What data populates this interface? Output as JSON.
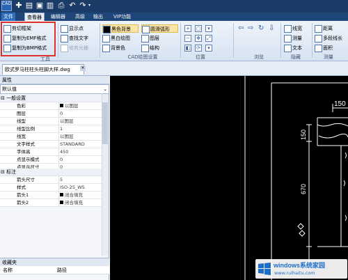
{
  "app": {
    "icon_label": "CAD"
  },
  "menu": [
    "文件",
    "查看器",
    "编辑器",
    "高级",
    "输出",
    "VIP功能"
  ],
  "ribbon": {
    "copy_group": {
      "items": [
        "剪切框架",
        "复制为EMF格式",
        "复制为BMP格式"
      ],
      "label": "工具"
    },
    "view_group": {
      "items": [
        "显示点",
        "查找文字",
        "修剪光栅"
      ]
    },
    "cad_group": {
      "col1": [
        "黑色背景",
        "黑白绘图",
        "背景色"
      ],
      "col2": [
        "圆滑弧形",
        "图层",
        "结构"
      ],
      "label": "CAD绘图设置"
    },
    "position_label": "位置",
    "browse_label": "浏览",
    "hide_group": {
      "items": [
        "线宽",
        "测量",
        "文本"
      ],
      "label": "隐藏"
    },
    "measure_group": {
      "items": [
        "距离",
        "多段线长",
        "面积"
      ],
      "label": "测量"
    }
  },
  "document": {
    "tab": "欧式罗马柱柱头柱脚大样.dwg"
  },
  "properties": {
    "title": "属性",
    "selector": "默认值",
    "general_header": "一般设置",
    "general": [
      {
        "k": "色彩",
        "v": "以图层",
        "swatch": true
      },
      {
        "k": "图层",
        "v": "0"
      },
      {
        "k": "线型",
        "v": "以图层"
      },
      {
        "k": "线型比例",
        "v": "1"
      },
      {
        "k": "线宽",
        "v": "以图层"
      },
      {
        "k": "文字样式",
        "v": "STANDARD"
      },
      {
        "k": "字体高",
        "v": "450"
      },
      {
        "k": "点显示模式",
        "v": "0"
      },
      {
        "k": "点显示尺寸",
        "v": "0"
      }
    ],
    "dim_header": "标注",
    "dim": [
      {
        "k": "箭头尺寸",
        "v": "5"
      },
      {
        "k": "样式",
        "v": "ISO-25_WS"
      },
      {
        "k": "箭头1",
        "v": "闭合填充",
        "swatch": true
      },
      {
        "k": "箭头2",
        "v": "闭合填充",
        "swatch": true
      }
    ]
  },
  "favorites": {
    "title": "收藏夹",
    "col_name": "名称",
    "col_path": "路径"
  },
  "drawing": {
    "dim_top": "150",
    "dim_left_1": "150",
    "dim_left_2": "670"
  },
  "watermark": {
    "brand": "windows系统家园",
    "url": "www.ruihaitu.com"
  },
  "colors": {
    "titlebar": "#1b3c66",
    "menubar": "#1f4678",
    "highlight_box": "#e0302a",
    "canvas": "#000000"
  }
}
